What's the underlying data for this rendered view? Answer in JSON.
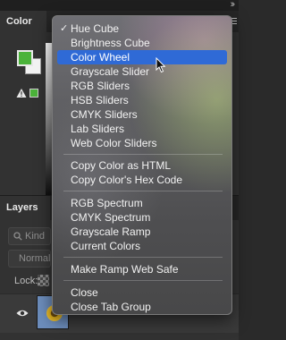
{
  "window": {
    "collapse_glyph": "››"
  },
  "color_panel": {
    "tab_label": "Color",
    "foreground_color": "#4bb33a",
    "background_color": "#f2f2f2"
  },
  "layers_panel": {
    "tab_label": "Layers",
    "kind_filter_label": "Kind",
    "blend_mode_label": "Normal",
    "lock_label": "Lock:"
  },
  "menu": {
    "checked_glyph": "✓",
    "items": [
      {
        "label": "Hue Cube",
        "checked": true
      },
      {
        "label": "Brightness Cube"
      },
      {
        "label": "Color Wheel",
        "selected": true
      },
      {
        "label": "Grayscale Slider"
      },
      {
        "label": "RGB Sliders"
      },
      {
        "label": "HSB Sliders"
      },
      {
        "label": "CMYK Sliders"
      },
      {
        "label": "Lab Sliders"
      },
      {
        "label": "Web Color Sliders"
      },
      {
        "label": "Copy Color as HTML"
      },
      {
        "label": "Copy Color's Hex Code"
      },
      {
        "label": "RGB Spectrum"
      },
      {
        "label": "CMYK Spectrum"
      },
      {
        "label": "Grayscale Ramp"
      },
      {
        "label": "Current Colors"
      },
      {
        "label": "Make Ramp Web Safe"
      },
      {
        "label": "Close"
      },
      {
        "label": "Close Tab Group"
      }
    ],
    "accent_color": "#2f6ad6"
  }
}
